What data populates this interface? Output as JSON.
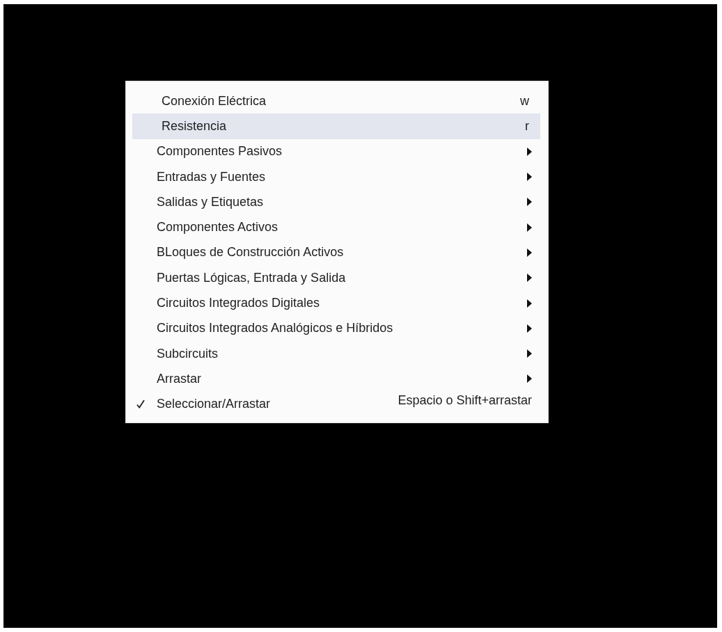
{
  "menu": {
    "items": [
      {
        "kind": "action",
        "label": "Conexión Eléctrica",
        "shortcut": "w",
        "selected": false,
        "checked": false
      },
      {
        "kind": "action",
        "label": "Resistencia",
        "shortcut": "r",
        "selected": true,
        "checked": false
      },
      {
        "kind": "submenu",
        "label": "Componentes Pasivos",
        "selected": false,
        "checked": false
      },
      {
        "kind": "submenu",
        "label": "Entradas y Fuentes",
        "selected": false,
        "checked": false
      },
      {
        "kind": "submenu",
        "label": "Salidas y Etiquetas",
        "selected": false,
        "checked": false
      },
      {
        "kind": "submenu",
        "label": "Componentes Activos",
        "selected": false,
        "checked": false
      },
      {
        "kind": "submenu",
        "label": "BLoques de Construcción Activos",
        "selected": false,
        "checked": false
      },
      {
        "kind": "submenu",
        "label": "Puertas Lógicas, Entrada y Salida",
        "selected": false,
        "checked": false
      },
      {
        "kind": "submenu",
        "label": "Circuitos Integrados Digitales",
        "selected": false,
        "checked": false
      },
      {
        "kind": "submenu",
        "label": "Circuitos Integrados Analógicos e Híbridos",
        "selected": false,
        "checked": false
      },
      {
        "kind": "submenu",
        "label": "Subcircuits",
        "selected": false,
        "checked": false
      },
      {
        "kind": "submenu",
        "label": "Arrastar",
        "selected": false,
        "checked": false
      },
      {
        "kind": "check",
        "label": "Seleccionar/Arrastar",
        "shortcut": "Espacio o Shift+arrastar",
        "selected": false,
        "checked": true
      }
    ]
  }
}
